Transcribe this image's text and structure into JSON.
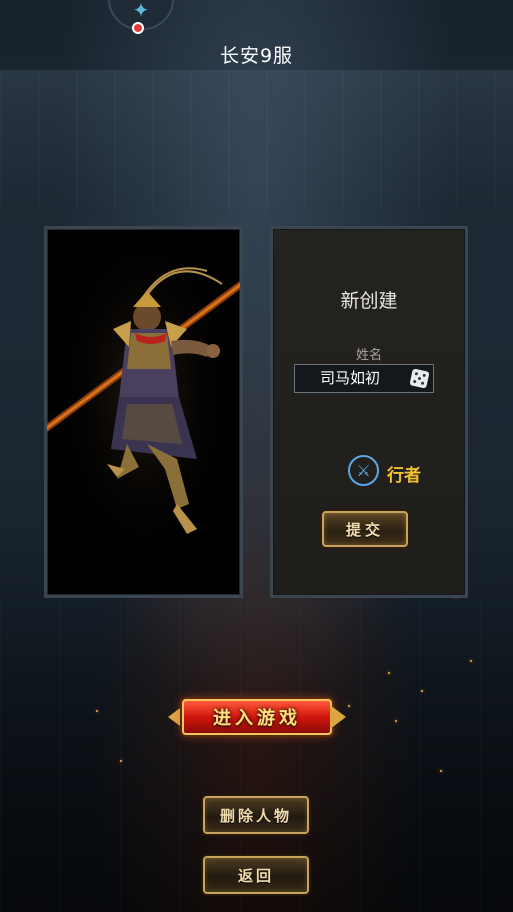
{
  "header": {
    "server_name": "长安9服",
    "avatar_icon": "bird-icon",
    "notification_color": "#e23b3b"
  },
  "character_portrait": {
    "description_icon": "monkey-king-warrior-portrait"
  },
  "create_form": {
    "title": "新创建",
    "name_label": "姓名",
    "name_value": "司马如初",
    "random_icon": "dice-icon",
    "class_icon": "sword-icon",
    "class_name": "行者",
    "class_color": "#f2c230",
    "submit_label": "提交"
  },
  "actions": {
    "enter_game_label": "进入游戏",
    "delete_character_label": "删除人物",
    "back_label": "返回"
  },
  "colors": {
    "accent_gold": "#c9a35c",
    "enter_red": "#d2160e"
  }
}
